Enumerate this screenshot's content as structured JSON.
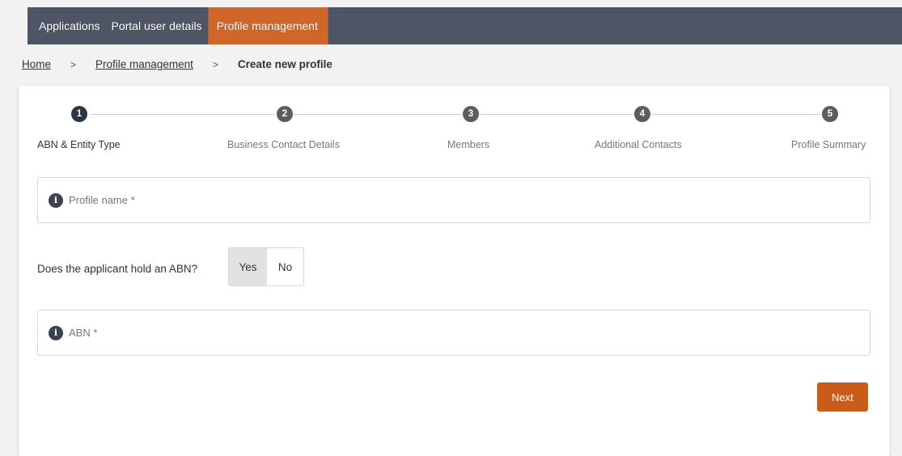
{
  "nav": {
    "tabs": [
      {
        "label": "Applications",
        "active": false
      },
      {
        "label": "Portal user details",
        "active": false
      },
      {
        "label": "Profile management",
        "active": true
      }
    ]
  },
  "breadcrumb": {
    "home": "Home",
    "separator": ">",
    "profile_management": "Profile management",
    "current": "Create new profile"
  },
  "stepper": {
    "steps": [
      {
        "number": "1",
        "label": "ABN & Entity Type",
        "active": true
      },
      {
        "number": "2",
        "label": "Business Contact Details",
        "active": false
      },
      {
        "number": "3",
        "label": "Members",
        "active": false
      },
      {
        "number": "4",
        "label": "Additional Contacts",
        "active": false
      },
      {
        "number": "5",
        "label": "Profile Summary",
        "active": false
      }
    ]
  },
  "form": {
    "profile_name_label": "Profile name *",
    "abn_question": "Does the applicant hold an ABN?",
    "yes_label": "Yes",
    "no_label": "No",
    "abn_label": "ABN *",
    "info_glyph": "i",
    "next_label": "Next"
  },
  "colors": {
    "nav_background": "#4e5565",
    "nav_active": "#d0672a",
    "primary_button": "#c85c1b",
    "active_step": "#2f3745",
    "inactive_step": "#5d5d5d",
    "page_background": "#f2f2f2"
  }
}
